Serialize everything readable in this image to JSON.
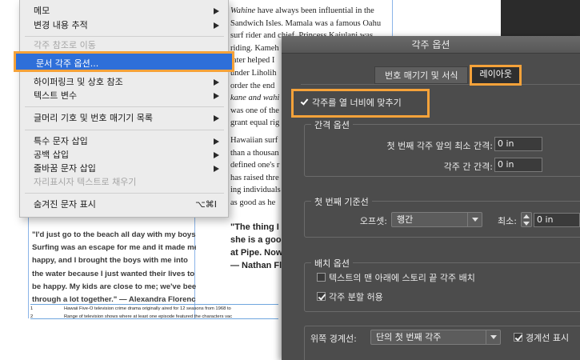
{
  "document": {
    "right_column_lines": [
      {
        "text": "Wahine have always been influential in the",
        "italic_lead": "Wahine"
      },
      {
        "text": "Sandwich Isles. Mamala was a famous Oahu"
      },
      {
        "text": "surf rider and chief. Princess Kaiulani was"
      },
      {
        "text": "riding. Kameh"
      },
      {
        "text": "later helped I"
      },
      {
        "text": "under Liholih"
      },
      {
        "text": "order the end"
      },
      {
        "text": "kane and wahi"
      },
      {
        "text": "was one of the"
      },
      {
        "text": "grant equal rig"
      }
    ],
    "right_column_lines_2": [
      "Hawaiian surf",
      "than a thousan",
      "defined one's r",
      "has raised thre",
      "ing individuals",
      "as good as he"
    ],
    "right_column_quote": [
      "\"The thing I li",
      "she is a good",
      "at Pipe. Now",
      "— Nathan Flo"
    ],
    "left_column_quote": [
      "\"I'd just go to the beach all day with my boys...",
      "Surfing was an escape for me and it made me",
      "happy, and I brought the boys with me into",
      "the water because I just wanted their lives to",
      "be happy. My kids are close to me; we've been",
      "through a lot together.\" — Alexandra Florence"
    ],
    "footnotes": [
      {
        "num": "1",
        "text": "Hawaii Five-O television crime drama originally aired for 12 seasons from 1968 to"
      },
      {
        "num": "2",
        "text": "Range of television shows where at least one episode featured the characters vac"
      }
    ]
  },
  "menu": {
    "items": [
      {
        "label": "메모",
        "submenu": true
      },
      {
        "label": "변경 내용 추적",
        "submenu": true
      },
      {
        "label": "각주 참조로 이동",
        "disabled": true
      },
      {
        "label": "문서 각주 옵션...",
        "selected": true
      },
      {
        "label": "하이퍼링크 및 상호 참조",
        "submenu": true
      },
      {
        "label": "텍스트 변수",
        "submenu": true
      },
      {
        "label": "글머리 기호 및 번호 매기기 목록",
        "submenu": true
      },
      {
        "label": "특수 문자 삽입",
        "submenu": true
      },
      {
        "label": "공백 삽입",
        "submenu": true
      },
      {
        "label": "줄바꿈 문자 삽입",
        "submenu": true
      },
      {
        "label": "자리표시자 텍스트로 채우기",
        "disabled": true
      },
      {
        "label": "숨겨진 문자 표시",
        "shortcut": "⌥⌘I"
      }
    ]
  },
  "dialog": {
    "title": "각주 옵션",
    "tabs": [
      {
        "label": "번호 매기기 및 서식",
        "active": false
      },
      {
        "label": "레이아웃",
        "active": true
      }
    ],
    "fit_to_column": {
      "label": "각주를 열 너비에 맞추기",
      "checked": true
    },
    "spacing": {
      "legend": "간격 옵션",
      "min_before_label": "첫 번째 각주 앞의 최소 간격:",
      "min_before_value": "0 in",
      "between_label": "각주 간 간격:",
      "between_value": "0 in"
    },
    "first_baseline": {
      "legend": "첫 번째 기준선",
      "offset_label": "오프셋:",
      "offset_value": "행간",
      "min_label": "최소:",
      "min_value": "0 in"
    },
    "placement": {
      "legend": "배치 옵션",
      "end_story_label": "텍스트의 맨 아래에 스토리 끝 각주 배치",
      "end_story_checked": false,
      "allow_split_label": "각주 분할 허용",
      "allow_split_checked": true
    },
    "rule": {
      "legend": "위쪽 경계선:",
      "type_value": "단의 첫 번째 각주",
      "rule_on_label": "경계선 표시",
      "rule_on_checked": true
    }
  }
}
